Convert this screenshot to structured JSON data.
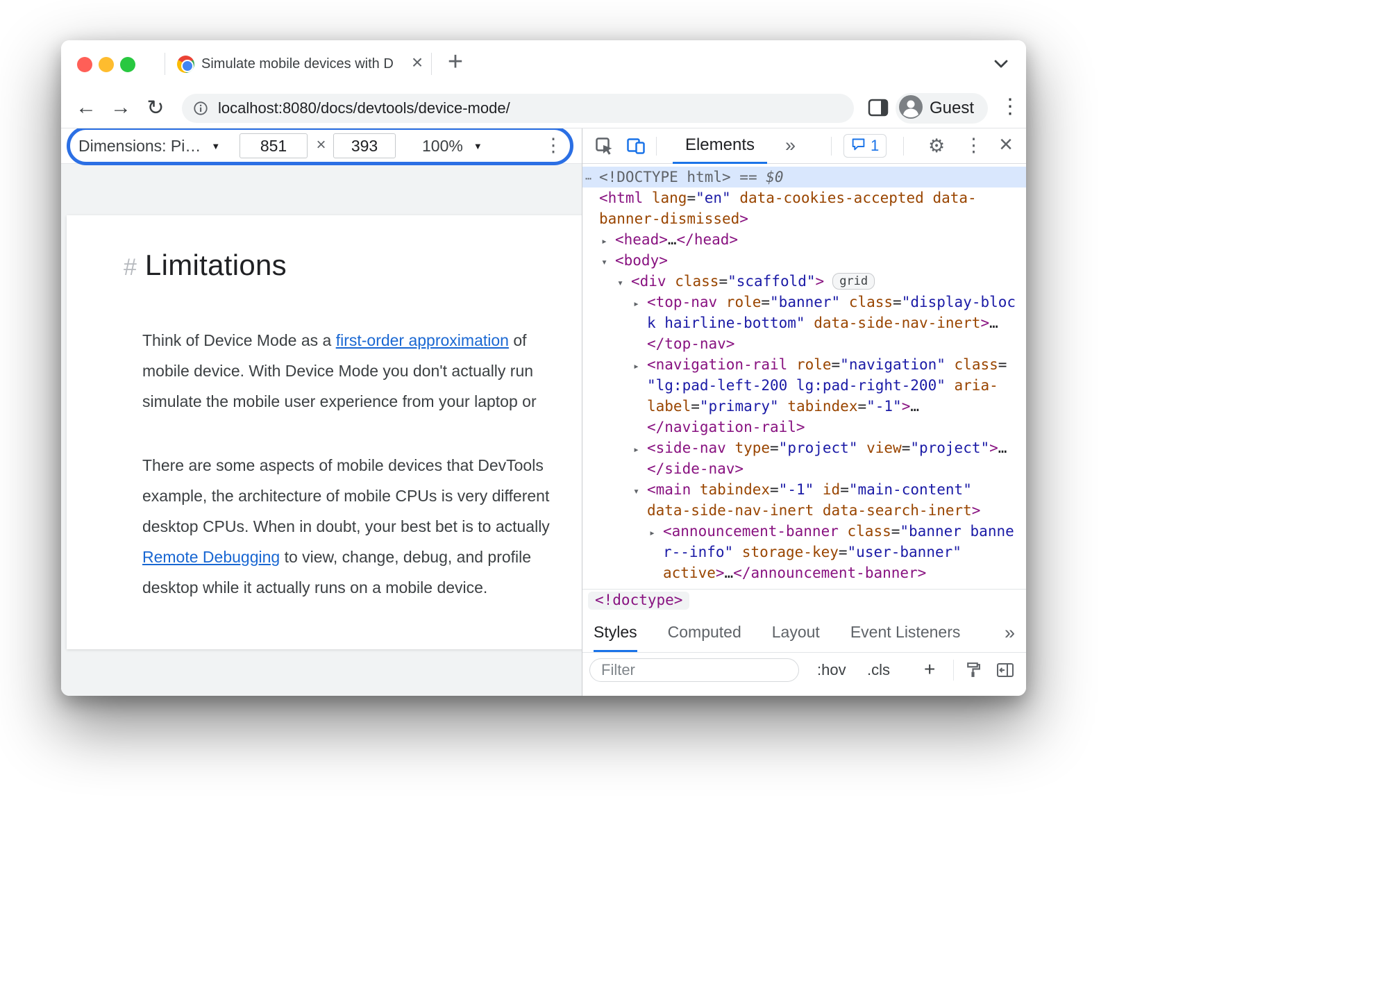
{
  "colors": {
    "accent": "#1a73e8",
    "highlight_box": "#2b6fe4",
    "code_tag": "#881280",
    "code_attr": "#994500",
    "code_value": "#1a1aa6",
    "code_gray": "#5f6368",
    "selection_bg": "#d9e7fd",
    "link": "#1967d2",
    "page_text": "#3c4043",
    "traffic_close": "#ff5f57",
    "traffic_min": "#febc2e",
    "traffic_max": "#28c840"
  },
  "icons": {
    "back": "←",
    "forward": "→",
    "reload": "↻",
    "kebab": "⋮",
    "gear": "⚙",
    "more": "»",
    "close": "×",
    "caret": "▼"
  },
  "tree_icons": {
    "r": "▸",
    "d": "▾",
    "e": "⋯"
  },
  "browser": {
    "tab_title": "Simulate mobile devices with D",
    "tab_close": "×",
    "new_tab": "+",
    "url": "localhost:8080/docs/devtools/device-mode/",
    "guest_label": "Guest"
  },
  "device_toolbar": {
    "dimensions_label": "Dimensions: Pi…",
    "width_value": "851",
    "separator": "×",
    "height_value": "393",
    "zoom_value": "100%"
  },
  "page": {
    "heading_anchor": "#",
    "heading": "Limitations",
    "paragraphs": [
      {
        "lines": [
          {
            "segs": [
              {
                "t": "Think of Device Mode as a "
              },
              {
                "t": "first-order approximation",
                "link": true
              },
              {
                "t": " of "
              }
            ]
          },
          {
            "segs": [
              {
                "t": "mobile device. With Device Mode you don't actually run"
              }
            ]
          },
          {
            "segs": [
              {
                "t": "simulate the mobile user experience from your laptop or"
              }
            ]
          }
        ]
      },
      {
        "lines": [
          {
            "segs": [
              {
                "t": "There are some aspects of mobile devices that DevTools"
              }
            ]
          },
          {
            "segs": [
              {
                "t": "example, the architecture of mobile CPUs is very different"
              }
            ]
          },
          {
            "segs": [
              {
                "t": "desktop CPUs. When in doubt, your best bet is to actually"
              }
            ]
          },
          {
            "segs": [
              {
                "t": "Remote Debugging",
                "link": true
              },
              {
                "t": " to view, change, debug, and profile "
              }
            ]
          },
          {
            "segs": [
              {
                "t": "desktop while it actually runs on a mobile device."
              }
            ]
          }
        ]
      }
    ]
  },
  "devtools": {
    "toolbar": {
      "elements_tab": "Elements",
      "more_tabs": "»",
      "console_count": "1",
      "close_label": "×"
    },
    "tree": {
      "lines": [
        {
          "i": 0,
          "ar": "e",
          "sel": true,
          "toks": [
            [
              "g",
              "<!DOCTYPE html>"
            ],
            [
              "g",
              " == "
            ],
            [
              "i",
              "$0"
            ]
          ]
        },
        {
          "i": 0,
          "toks": [
            [
              "t",
              "<html"
            ],
            [
              "a",
              " lang"
            ],
            [
              "p",
              "="
            ],
            [
              "v",
              "\"en\""
            ],
            [
              "a",
              " data-cookies-accepted"
            ],
            [
              "a",
              " data-"
            ]
          ]
        },
        {
          "i": 0,
          "toks": [
            [
              "a",
              "banner-dismissed"
            ],
            [
              "t",
              ">"
            ]
          ]
        },
        {
          "i": 1,
          "ar": "r",
          "toks": [
            [
              "t",
              "<head"
            ],
            [
              "t",
              ">"
            ],
            [
              "p",
              "…"
            ],
            [
              "t",
              "</head>"
            ]
          ]
        },
        {
          "i": 1,
          "ar": "d",
          "toks": [
            [
              "t",
              "<body"
            ],
            [
              "t",
              ">"
            ]
          ]
        },
        {
          "i": 2,
          "ar": "d",
          "badge": "grid",
          "toks": [
            [
              "t",
              "<div"
            ],
            [
              "a",
              " class"
            ],
            [
              "p",
              "="
            ],
            [
              "v",
              "\"scaffold\""
            ],
            [
              "t",
              ">"
            ]
          ]
        },
        {
          "i": 3,
          "ar": "r",
          "toks": [
            [
              "t",
              "<top-nav"
            ],
            [
              "a",
              " role"
            ],
            [
              "p",
              "="
            ],
            [
              "v",
              "\"banner\""
            ],
            [
              "a",
              " class"
            ],
            [
              "p",
              "="
            ],
            [
              "v",
              "\"display-bloc"
            ]
          ]
        },
        {
          "i": 3,
          "toks": [
            [
              "v",
              "k hairline-bottom\""
            ],
            [
              "a",
              " data-side-nav-inert"
            ],
            [
              "t",
              ">"
            ],
            [
              "p",
              "…"
            ]
          ]
        },
        {
          "i": 3,
          "toks": [
            [
              "t",
              "</top-nav>"
            ]
          ]
        },
        {
          "i": 3,
          "ar": "r",
          "toks": [
            [
              "t",
              "<navigation-rail"
            ],
            [
              "a",
              " role"
            ],
            [
              "p",
              "="
            ],
            [
              "v",
              "\"navigation\""
            ],
            [
              "a",
              " class"
            ],
            [
              "p",
              "="
            ]
          ]
        },
        {
          "i": 3,
          "toks": [
            [
              "v",
              "\"lg:pad-left-200 lg:pad-right-200\""
            ],
            [
              "a",
              " aria-"
            ]
          ]
        },
        {
          "i": 3,
          "toks": [
            [
              "a",
              "label"
            ],
            [
              "p",
              "="
            ],
            [
              "v",
              "\"primary\""
            ],
            [
              "a",
              " tabindex"
            ],
            [
              "p",
              "="
            ],
            [
              "v",
              "\"-1\""
            ],
            [
              "t",
              ">"
            ],
            [
              "p",
              "…"
            ]
          ]
        },
        {
          "i": 3,
          "toks": [
            [
              "t",
              "</navigation-rail>"
            ]
          ]
        },
        {
          "i": 3,
          "ar": "r",
          "toks": [
            [
              "t",
              "<side-nav"
            ],
            [
              "a",
              " type"
            ],
            [
              "p",
              "="
            ],
            [
              "v",
              "\"project\""
            ],
            [
              "a",
              " view"
            ],
            [
              "p",
              "="
            ],
            [
              "v",
              "\"project\""
            ],
            [
              "t",
              ">"
            ],
            [
              "p",
              "…"
            ]
          ]
        },
        {
          "i": 3,
          "toks": [
            [
              "t",
              "</side-nav>"
            ]
          ]
        },
        {
          "i": 3,
          "ar": "d",
          "toks": [
            [
              "t",
              "<main"
            ],
            [
              "a",
              " tabindex"
            ],
            [
              "p",
              "="
            ],
            [
              "v",
              "\"-1\""
            ],
            [
              "a",
              " id"
            ],
            [
              "p",
              "="
            ],
            [
              "v",
              "\"main-content\""
            ]
          ]
        },
        {
          "i": 3,
          "toks": [
            [
              "a",
              "data-side-nav-inert"
            ],
            [
              "a",
              " data-search-inert"
            ],
            [
              "t",
              ">"
            ]
          ]
        },
        {
          "i": 4,
          "ar": "r",
          "toks": [
            [
              "t",
              "<announcement-banner"
            ],
            [
              "a",
              " class"
            ],
            [
              "p",
              "="
            ],
            [
              "v",
              "\"banner banne"
            ]
          ]
        },
        {
          "i": 4,
          "toks": [
            [
              "v",
              "r--info\""
            ],
            [
              "a",
              " storage-key"
            ],
            [
              "p",
              "="
            ],
            [
              "v",
              "\"user-banner\""
            ]
          ]
        },
        {
          "i": 4,
          "toks": [
            [
              "a",
              "active"
            ],
            [
              "t",
              ">"
            ],
            [
              "p",
              "…"
            ],
            [
              "t",
              "</announcement-banner>"
            ]
          ]
        }
      ]
    },
    "breadcrumb": "<!doctype>",
    "styles_tabs": [
      {
        "label": "Styles",
        "active": true
      },
      {
        "label": "Computed"
      },
      {
        "label": "Layout"
      },
      {
        "label": "Event Listeners"
      }
    ],
    "styles_more": "»",
    "filter_placeholder": "Filter",
    "hov_label": ":hov",
    "cls_label": ".cls",
    "plus_label": "+"
  }
}
